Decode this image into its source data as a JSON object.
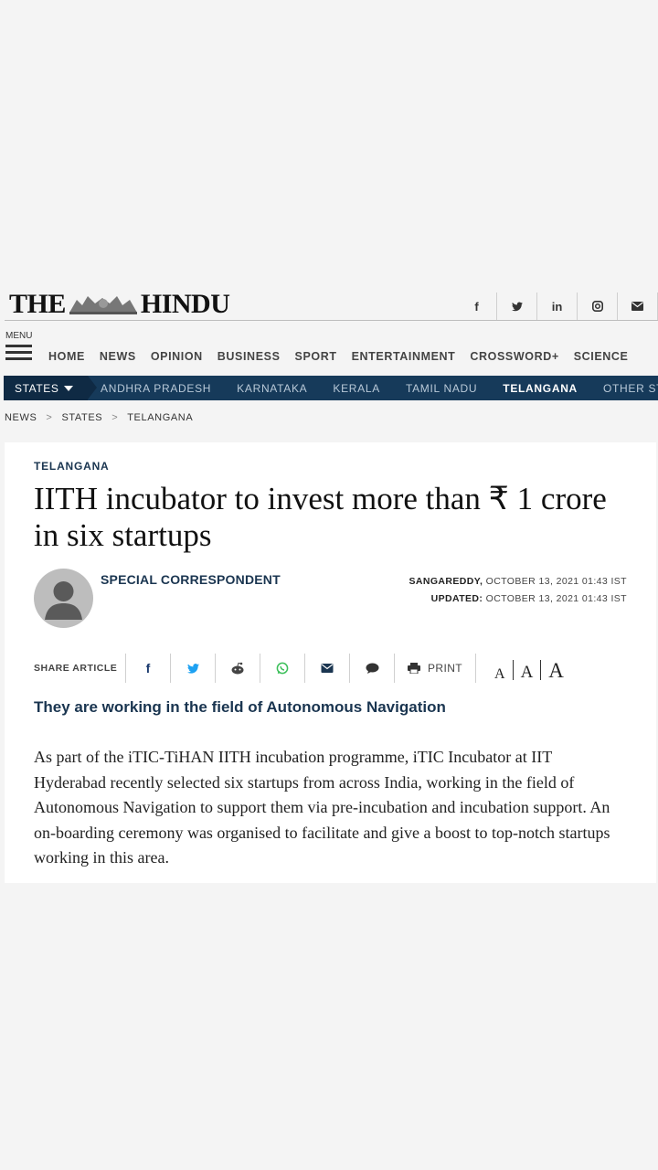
{
  "header": {
    "logo_left": "THE",
    "logo_right": "HINDU",
    "social_icons": [
      "facebook-icon",
      "twitter-icon",
      "linkedin-icon",
      "instagram-icon",
      "email-icon"
    ]
  },
  "menu": {
    "label": "MENU"
  },
  "main_nav": [
    "HOME",
    "NEWS",
    "OPINION",
    "BUSINESS",
    "SPORT",
    "ENTERTAINMENT",
    "CROSSWORD+",
    "SCIENCE"
  ],
  "states_nav": {
    "button_label": "STATES",
    "items": [
      "ANDHRA PRADESH",
      "KARNATAKA",
      "KERALA",
      "TAMIL NADU",
      "TELANGANA",
      "OTHER STATES"
    ],
    "active": "TELANGANA"
  },
  "breadcrumb": [
    "NEWS",
    "STATES",
    "TELANGANA"
  ],
  "article": {
    "kicker": "TELANGANA",
    "headline": "IITH incubator to invest more than ₹ 1 crore in six startups",
    "author": "SPECIAL CORRESPONDENT",
    "dateline_place": "SANGAREDDY,",
    "dateline_date": "OCTOBER 13, 2021 01:43 IST",
    "updated_label": "UPDATED:",
    "updated_date": "OCTOBER 13, 2021 01:43 IST",
    "share_label": "SHARE ARTICLE",
    "print_label": "PRINT",
    "font_sizes": [
      "A",
      "A",
      "A"
    ],
    "standfirst": "They are working in the field of Autonomous Navigation",
    "body": "As part of the iTIC-TiHAN IITH incubation programme, iTIC Incubator at IIT Hyderabad recently selected six startups from across India, working in the field of Autonomous Navigation to support them via pre-incubation and incubation support. An on-boarding ceremony was organised to facilitate and give a boost to top-notch startups working in this area."
  },
  "colors": {
    "navy": "#163a5a",
    "navy_dark": "#0f2a44",
    "accent_text": "#1a3550",
    "whatsapp": "#3cbf5a",
    "twitter": "#1da1f2",
    "facebook": "#1a3a6e"
  }
}
